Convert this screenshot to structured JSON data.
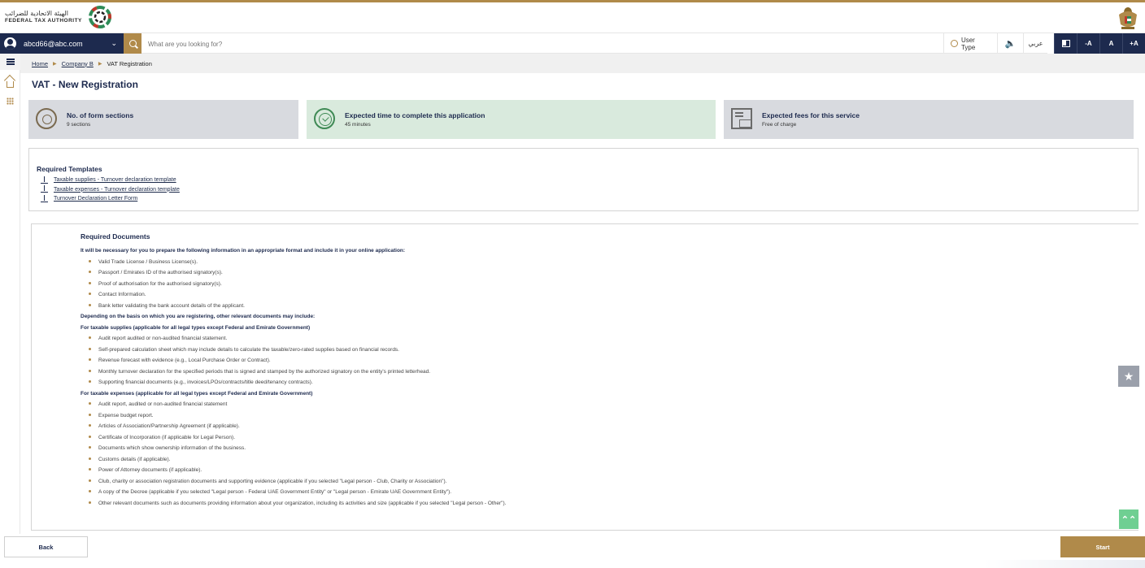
{
  "header": {
    "logo_ar": "الهيئة الاتحادية للضرائب",
    "logo_en": "FEDERAL TAX AUTHORITY"
  },
  "toolbar": {
    "user_email": "abcd66@abc.com",
    "search_placeholder": "What are you looking for?",
    "user_type_label": "User Type",
    "arabic_label": "عربي",
    "font_decrease": "-A",
    "font_normal": "A",
    "font_increase": "+A"
  },
  "breadcrumb": {
    "home": "Home",
    "company": "Company B",
    "current": "VAT Registration"
  },
  "page": {
    "title": "VAT - New Registration"
  },
  "cards": [
    {
      "title": "No. of form sections",
      "value": "9 sections"
    },
    {
      "title": "Expected time to complete this application",
      "value": "45 minutes"
    },
    {
      "title": "Expected fees for this service",
      "value": "Free of charge"
    }
  ],
  "templates": {
    "title": "Required Templates",
    "items": [
      "Taxable supplies - Turnover declaration template",
      "Taxable expenses - Turnover declaration template",
      "Turnover Declaration Letter Form"
    ]
  },
  "documents": {
    "title": "Required Documents",
    "intro": "It will be necessary for you to prepare the following information in an appropriate format and include it in your online application:",
    "general": [
      "Valid Trade License / Business License(s).",
      "Passport / Emirates ID of the authorised signatory(s).",
      "Proof of authorisation for the authorised signatory(s).",
      "Contact Information.",
      "Bank letter validating the bank account details of the applicant."
    ],
    "basis_intro": "Depending on the basis on which you are registering, other relevant documents may include:",
    "supplies_heading": "For taxable supplies (applicable for all legal types except Federal and Emirate Government)",
    "supplies": [
      "Audit report audited or non-audited financial statement.",
      "Self-prepared calculation sheet which may include details to calculate the taxable/zero-rated supplies based on financial records.",
      "Revenue forecast with evidence (e.g., Local Purchase Order or Contract).",
      "Monthly turnover declaration for the specified periods that is signed and stamped by the authorized signatory on the entity's printed letterhead.",
      "Supporting financial documents (e.g., invoices/LPOs/contracts/title deed/tenancy contracts)."
    ],
    "expenses_heading": "For taxable expenses (applicable for all legal types except Federal and Emirate Government)",
    "expenses": [
      "Audit report, audited or non-audited financial statement",
      "Expense budget report.",
      "Articles of Association/Partnership Agreement (if applicable).",
      "Certificate of Incorporation (if applicable for Legal Person).",
      "Documents which show ownership information of the business.",
      "Customs details (if applicable).",
      "Power of Attorney documents (if applicable).",
      "Club, charity or association registration documents and supporting evidence (applicable if you selected \"Legal person - Club, Charity or Association\").",
      "A copy of the Decree (applicable if you selected \"Legal person - Federal UAE Government Entity\" or \"Legal person - Emirate UAE Government Entity\").",
      "Other relevant documents such as documents providing information about your organization, including its activities and size (applicable if you selected \"Legal person - Other\")."
    ]
  },
  "footer": {
    "back_label": "Back",
    "start_label": "Start"
  },
  "colors": {
    "navy": "#1d2a4e",
    "gold": "#b08a4a",
    "card_grey": "#d8dadf",
    "card_green": "#d9eadd",
    "scroll_top_green": "#6fcf92"
  },
  "icons": {
    "user": "user-avatar-icon",
    "search": "search-icon",
    "menu": "hamburger-menu-icon",
    "home": "home-icon",
    "apps": "grid-apps-icon",
    "sections": "gear-icon",
    "time": "clock-check-icon",
    "fees": "invoice-money-icon",
    "download": "download-icon",
    "favorite": "star-icon",
    "scroll_top": "double-chevron-up-icon"
  }
}
